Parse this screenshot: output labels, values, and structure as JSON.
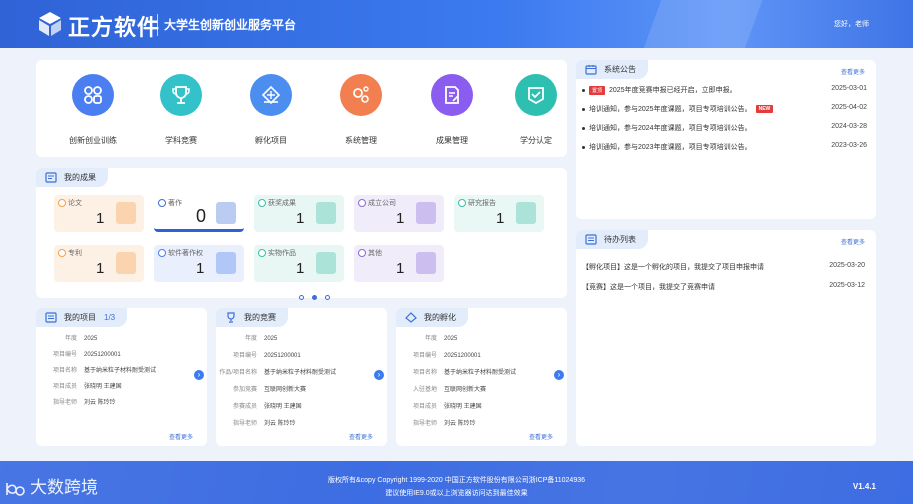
{
  "header": {
    "brand": "正方软件",
    "platform": "大学生创新创业服务平台",
    "greeting": "您好，老师"
  },
  "apps": [
    {
      "label": "创新创业训练",
      "icon": "grid-apps-icon",
      "color": "#4b7ef0"
    },
    {
      "label": "学科竞赛",
      "icon": "trophy-icon",
      "color": "#33c2c9"
    },
    {
      "label": "孵化项目",
      "icon": "incubator-icon",
      "color": "#4b8ef0"
    },
    {
      "label": "系统管理",
      "icon": "gears-icon",
      "color": "#f27f50"
    },
    {
      "label": "成果管理",
      "icon": "document-edit-icon",
      "color": "#8a5cf0"
    },
    {
      "label": "学分认定",
      "icon": "certificate-icon",
      "color": "#2dbfb0"
    }
  ],
  "achievements": {
    "title": "我的成果",
    "tiles": [
      {
        "name": "论文",
        "value": "1",
        "color": "#f5a04a",
        "bg": "#fdf1e6"
      },
      {
        "name": "著作",
        "value": "0",
        "color": "#3b6fd8",
        "bg": "#ffffff"
      },
      {
        "name": "获奖成果",
        "value": "1",
        "color": "#3bbfa8",
        "bg": "#e8f7f3"
      },
      {
        "name": "成立公司",
        "value": "1",
        "color": "#8a6ad8",
        "bg": "#f0ecfa"
      },
      {
        "name": "研究报告",
        "value": "1",
        "color": "#3bbfa8",
        "bg": "#e9f8f4"
      },
      {
        "name": "专利",
        "value": "1",
        "color": "#f5a04a",
        "bg": "#fdf1e6"
      },
      {
        "name": "软件著作权",
        "value": "1",
        "color": "#4b7ef0",
        "bg": "#e9effc"
      },
      {
        "name": "实物作品",
        "value": "1",
        "color": "#3bbfa8",
        "bg": "#e8f7f3"
      },
      {
        "name": "其他",
        "value": "1",
        "color": "#8a6ad8",
        "bg": "#f0ecfa"
      }
    ],
    "active_page": 2,
    "pages": 3
  },
  "project": {
    "title": "我的项目",
    "page": "1/3",
    "rows": [
      {
        "k": "年度",
        "v": "2025"
      },
      {
        "k": "项目编号",
        "v": "20251200001"
      },
      {
        "k": "项目名称",
        "v": "基于纳米粒子材料耐受测试"
      },
      {
        "k": "项目成员",
        "v": "张晓明  王建国"
      },
      {
        "k": "指导老师",
        "v": "刘云  陈玲玲"
      }
    ],
    "more": "查看更多"
  },
  "competition": {
    "title": "我的竞赛",
    "rows": [
      {
        "k": "年度",
        "v": "2025"
      },
      {
        "k": "项目编号",
        "v": "20251200001"
      },
      {
        "k": "作品/项目名称",
        "v": "基于纳米粒子材料耐受测试"
      },
      {
        "k": "参加竞赛",
        "v": "互联网创新大赛"
      },
      {
        "k": "参赛成员",
        "v": "张晓明  王建国"
      },
      {
        "k": "指导老师",
        "v": "刘云  陈玲玲"
      }
    ],
    "more": "查看更多"
  },
  "incubation": {
    "title": "我的孵化",
    "rows": [
      {
        "k": "年度",
        "v": "2025"
      },
      {
        "k": "项目编号",
        "v": "20251200001"
      },
      {
        "k": "项目名称",
        "v": "基于纳米粒子材料耐受测试"
      },
      {
        "k": "入驻基地",
        "v": "互联网创新大赛"
      },
      {
        "k": "项目成员",
        "v": "张晓明  王建国"
      },
      {
        "k": "指导老师",
        "v": "刘云  陈玲玲"
      }
    ],
    "more": "查看更多"
  },
  "notices": {
    "title": "系统公告",
    "more": "查看更多",
    "items": [
      {
        "text": "2025年度竞赛申报已经开启，立即申报。",
        "date": "2025-03-01",
        "tag_before": "置顶",
        "tag_after": ""
      },
      {
        "text": "培训通知，参与2025年度课题，项目专项培训公告。",
        "date": "2025-04-02",
        "tag_before": "",
        "tag_after": "NEW"
      },
      {
        "text": "培训通知，参与2024年度课题，项目专项培训公告。",
        "date": "2024-03-28",
        "tag_before": "",
        "tag_after": ""
      },
      {
        "text": "培训通知，参与2023年度课题，项目专项培训公告。",
        "date": "2023-03-26",
        "tag_before": "",
        "tag_after": ""
      }
    ]
  },
  "todos": {
    "title": "待办列表",
    "more": "查看更多",
    "items": [
      {
        "text": "【孵化项目】这是一个孵化的项目，我提交了项目申报申请",
        "date": "2025-03-20"
      },
      {
        "text": "【竞赛】这是一个项目，我提交了竞赛申请",
        "date": "2025-03-12"
      }
    ]
  },
  "footer": {
    "copyright": "版权所有&copy Copyright 1999-2020 中国正方软件股份有限公司浙ICP备11024936",
    "browser_tip": "建议使用IE9.0或以上浏览器访问达到最佳效果",
    "version": "V1.4.1",
    "watermark": "大数跨境"
  }
}
